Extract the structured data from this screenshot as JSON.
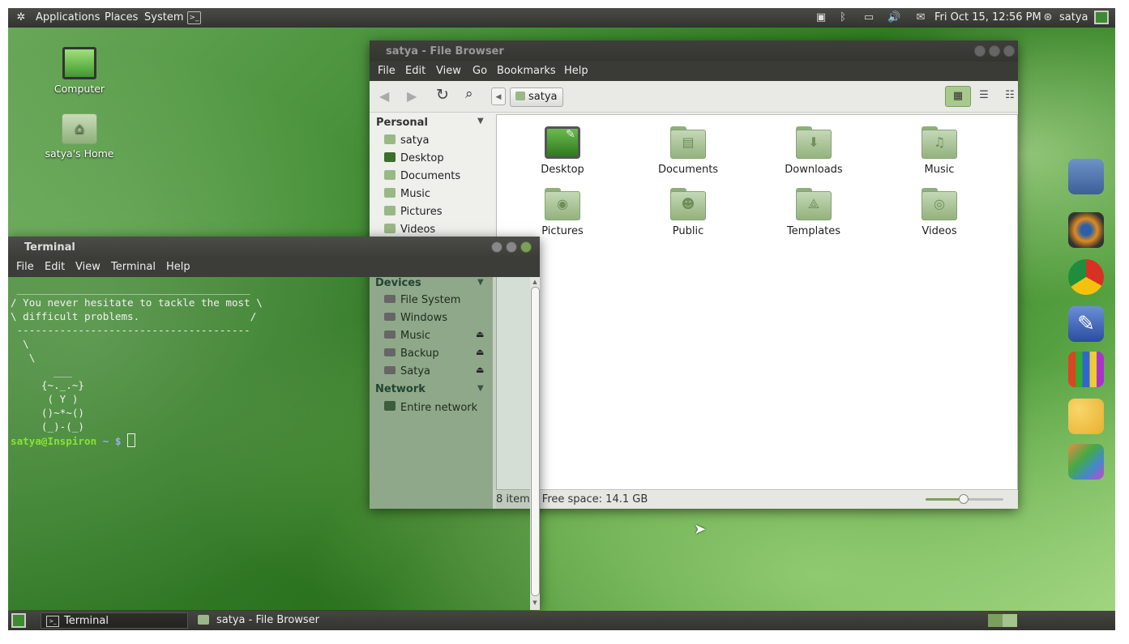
{
  "top_panel": {
    "menus": [
      "Applications",
      "Places",
      "System"
    ],
    "datetime": "Fri Oct 15, 12:56 PM",
    "user": "satya"
  },
  "desktop": {
    "icons": [
      {
        "label": "Computer"
      },
      {
        "label": "satya's Home"
      }
    ]
  },
  "file_browser": {
    "title": "satya - File Browser",
    "menu": [
      "File",
      "Edit",
      "View",
      "Go",
      "Bookmarks",
      "Help"
    ],
    "location": "satya",
    "sidebar": {
      "personal_header": "Personal",
      "personal": [
        "satya",
        "Desktop",
        "Documents",
        "Music",
        "Pictures",
        "Videos"
      ],
      "devices_header": "Devices",
      "devices": [
        "File System",
        "Windows",
        "Music",
        "Backup",
        "Satya"
      ],
      "network_header": "Network",
      "network": [
        "Entire network"
      ]
    },
    "folders": [
      "Desktop",
      "Documents",
      "Downloads",
      "Music",
      "Pictures",
      "Public",
      "Templates",
      "Videos"
    ],
    "status": "8 items, Free space: 14.1 GB"
  },
  "terminal": {
    "title": "Terminal",
    "menu": [
      "File",
      "Edit",
      "View",
      "Terminal",
      "Help"
    ],
    "output": " ______________________________________\n/ You never hesitate to tackle the most \\\n\\ difficult problems.                  /\n --------------------------------------\n  \\\n   \\\n       ___\n     {~._.~}\n      ( Y )\n     ()~*~()\n     (_)-(_)",
    "prompt_user": "satya@Inspiron",
    "prompt_rest": " ~ $ "
  },
  "taskbar": {
    "items": [
      "Terminal",
      "satya - File Browser"
    ]
  },
  "colors": {
    "accent": "#7ba05b",
    "prompt": "#8ae234"
  }
}
